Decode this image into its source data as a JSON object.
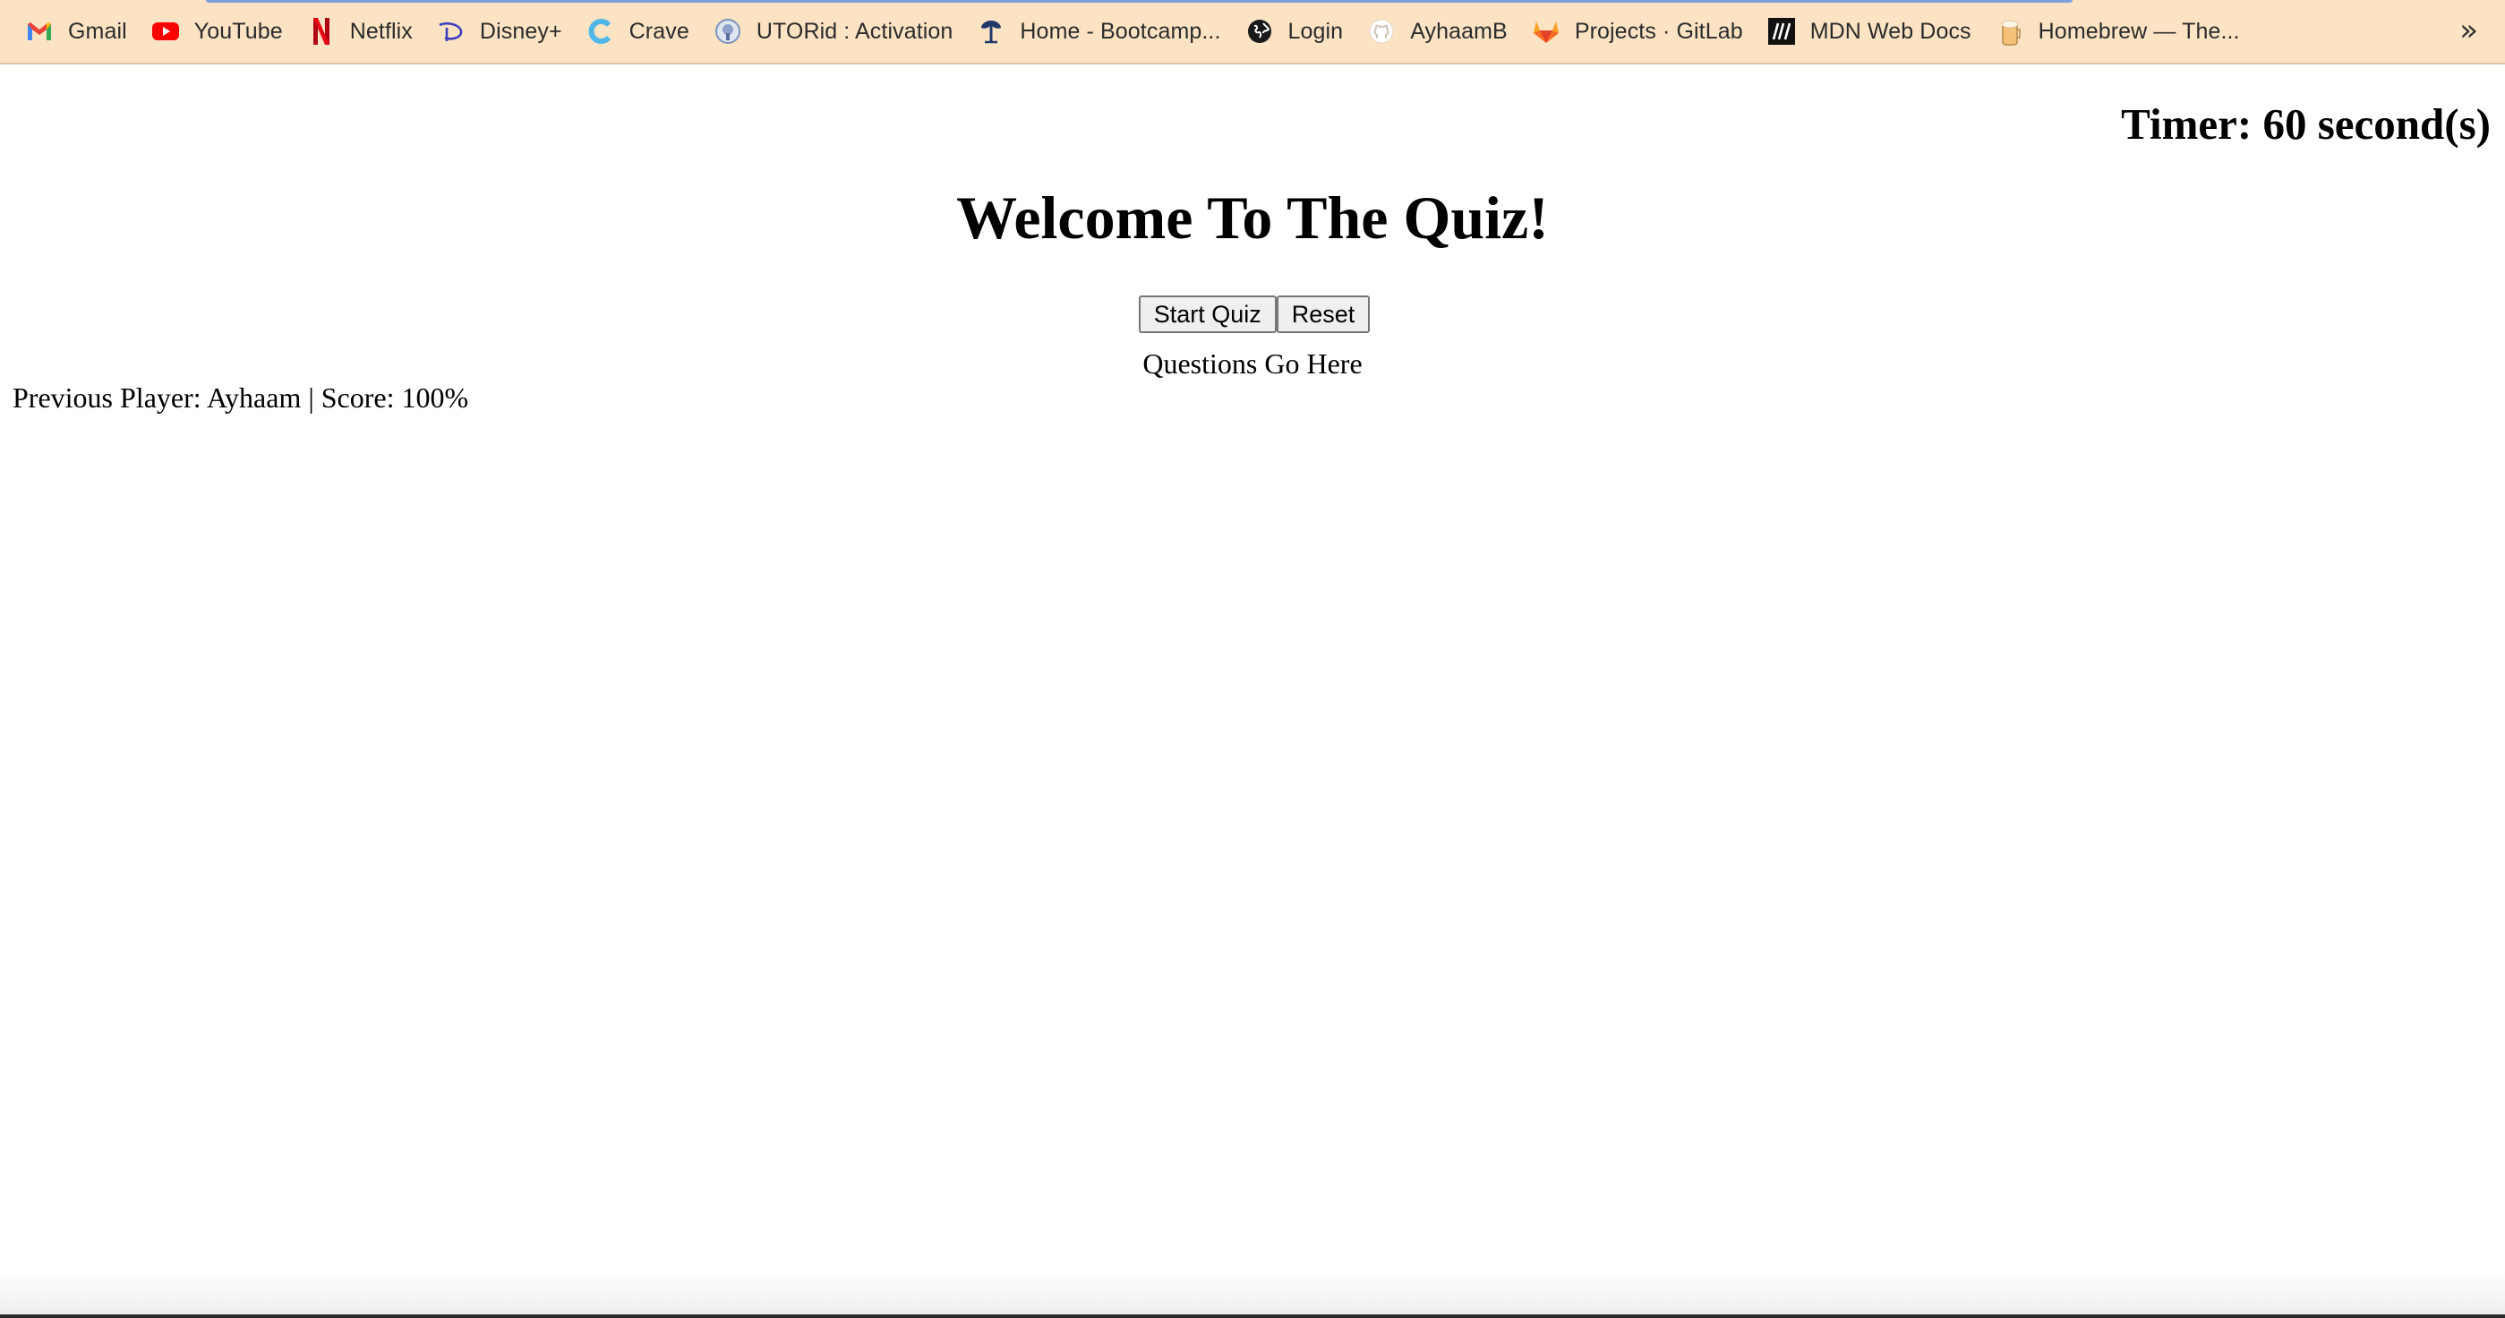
{
  "bookmarks": [
    {
      "label": "Gmail",
      "icon": "gmail-icon"
    },
    {
      "label": "YouTube",
      "icon": "youtube-icon"
    },
    {
      "label": "Netflix",
      "icon": "netflix-icon"
    },
    {
      "label": "Disney+",
      "icon": "disney-plus-icon"
    },
    {
      "label": "Crave",
      "icon": "crave-icon"
    },
    {
      "label": "UTORid : Activation",
      "icon": "utoronto-icon"
    },
    {
      "label": "Home - Bootcamp...",
      "icon": "bootcamp-tree-icon"
    },
    {
      "label": "Login",
      "icon": "globe-icon"
    },
    {
      "label": "AyhaamB",
      "icon": "github-icon"
    },
    {
      "label": "Projects · GitLab",
      "icon": "gitlab-icon"
    },
    {
      "label": "MDN Web Docs",
      "icon": "mdn-icon"
    },
    {
      "label": "Homebrew — The...",
      "icon": "homebrew-icon"
    }
  ],
  "bookmarks_overflow": "»",
  "timer": "Timer: 60 second(s)",
  "title": "Welcome To The Quiz!",
  "buttons": {
    "start": "Start Quiz",
    "reset": "Reset"
  },
  "questions_placeholder": "Questions Go Here",
  "previous_player": "Previous Player: Ayhaam | Score: 100%"
}
